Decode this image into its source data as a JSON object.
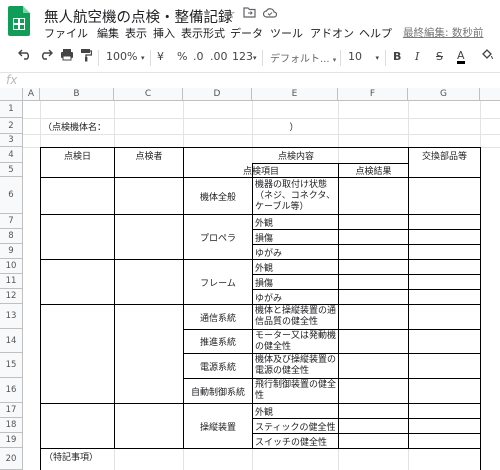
{
  "title": "無人航空機の点検・整備記録",
  "menu": [
    "ファイル",
    "編集",
    "表示",
    "挿入",
    "表示形式",
    "データ",
    "ツール",
    "アドオン",
    "ヘルプ"
  ],
  "last_edit": "最終編集: 数秒前",
  "toolbar": {
    "zoom": "100%",
    "currency": "¥",
    "percent": "%",
    "decimal_decrease": ".0",
    "decimal_increase": ".00",
    "number_format": "123",
    "font": "デフォルト...",
    "font_size": "10",
    "bold": "B",
    "italic": "I",
    "strike": "S",
    "text_color": "A"
  },
  "formula_icon": "fx",
  "columns": [
    "A",
    "B",
    "C",
    "D",
    "E",
    "F",
    "G"
  ],
  "rows": [
    "1",
    "2",
    "3",
    "4",
    "5",
    "6",
    "7",
    "8",
    "9",
    "10",
    "11",
    "12",
    "13",
    "14",
    "15",
    "16",
    "17",
    "18",
    "19",
    "20"
  ],
  "sheet": {
    "aircraft_label": "（点検機体名：",
    "aircraft_close": "）",
    "h_date": "点検日",
    "h_inspector": "点検者",
    "h_content": "点検内容",
    "h_parts": "交換部品等",
    "h_item": "点検項目",
    "h_result": "点検結果",
    "groups": {
      "body": "機体全般",
      "prop": "プロペラ",
      "frame": "フレーム",
      "comm": "通信系統",
      "prop_sys": "推進系統",
      "power": "電源系統",
      "auto": "自動制御系統",
      "ctrl": "操縦装置"
    },
    "items": {
      "r6": "機器の取付け状態（ネジ、コネクタ、ケーブル等）",
      "r7": "外観",
      "r8": "損傷",
      "r9": "ゆがみ",
      "r10": "外観",
      "r11": "損傷",
      "r12": "ゆがみ",
      "r13": "機体と操縦装置の通信品質の健全性",
      "r14": "モーター又は発動機の健全性",
      "r15": "機体及び操縦装置の電源の健全性",
      "r16": "飛行制御装置の健全性",
      "r17": "外観",
      "r18": "スティックの健全性",
      "r19": "スイッチの健全性"
    },
    "notes": "（特記事項）"
  }
}
